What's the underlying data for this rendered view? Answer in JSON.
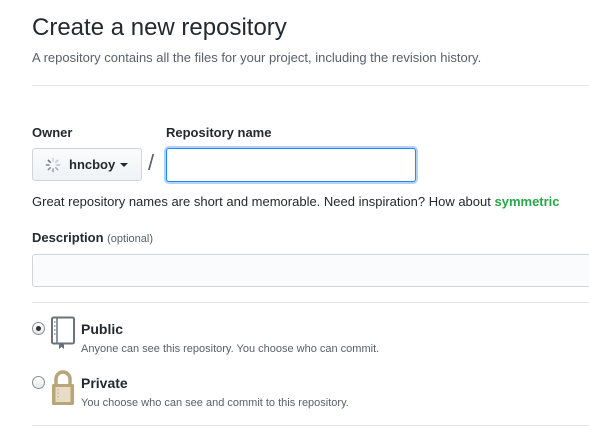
{
  "header": {
    "title": "Create a new repository",
    "subtitle": "A repository contains all the files for your project, including the revision history."
  },
  "owner": {
    "label": "Owner",
    "value": "hncboy"
  },
  "separator": "/",
  "repo_name": {
    "label": "Repository name",
    "value": "",
    "placeholder": ""
  },
  "hint": {
    "text": "Great repository names are short and memorable. Need inspiration? How about",
    "suggestion": "symmetric"
  },
  "description": {
    "label": "Description",
    "optional": "(optional)",
    "value": ""
  },
  "visibility": {
    "selected": "public",
    "options": [
      {
        "id": "public",
        "title": "Public",
        "description": "Anyone can see this repository. You choose who can commit.",
        "icon": "repo-book-icon"
      },
      {
        "id": "private",
        "title": "Private",
        "description": "You choose who can see and commit to this repository.",
        "icon": "lock-icon"
      }
    ]
  },
  "colors": {
    "focus_border": "#2188ff",
    "suggestion": "#28a745",
    "lock_gold": "#b8a57a"
  }
}
